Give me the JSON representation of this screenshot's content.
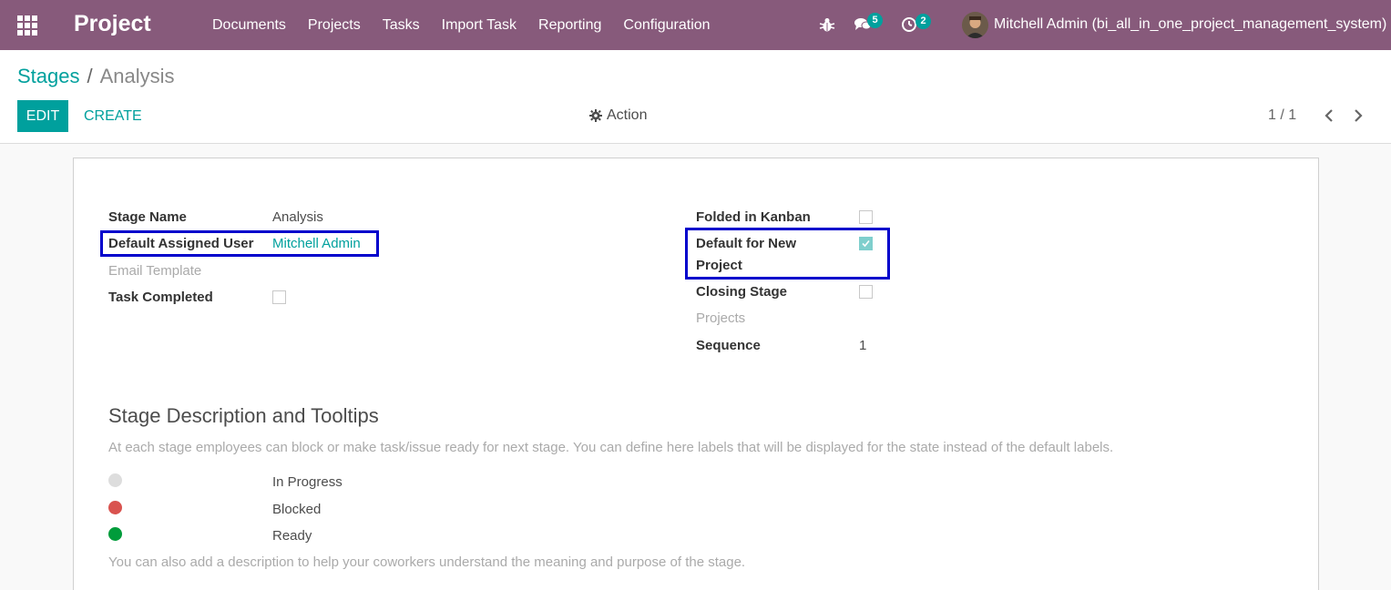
{
  "navbar": {
    "brand": "Project",
    "menu": [
      "Documents",
      "Projects",
      "Tasks",
      "Import Task",
      "Reporting",
      "Configuration"
    ],
    "chat_count": "5",
    "activity_count": "2",
    "user": "Mitchell Admin (bi_all_in_one_project_management_system)",
    "color": "#875a7b"
  },
  "breadcrumb": {
    "parent": "Stages",
    "separator": "/",
    "current": "Analysis"
  },
  "buttons": {
    "edit": "EDIT",
    "create": "CREATE",
    "action": "Action"
  },
  "pager": {
    "value": "1 / 1"
  },
  "form": {
    "stage_name_label": "Stage Name",
    "stage_name_value": "Analysis",
    "default_user_label": "Default Assigned User",
    "default_user_value": "Mitchell Admin",
    "email_template_label": "Email Template",
    "task_completed_label": "Task Completed",
    "task_completed": false,
    "folded_label": "Folded in Kanban",
    "folded": false,
    "default_new_project_label_1": "Default for New",
    "default_new_project_label_2": "Project",
    "default_new_project": true,
    "closing_label": "Closing Stage",
    "closing": false,
    "projects_label": "Projects",
    "sequence_label": "Sequence",
    "sequence_value": "1"
  },
  "description": {
    "title": "Stage Description and Tooltips",
    "help": "At each stage employees can block or make task/issue ready for next stage. You can define here labels that will be displayed for the state instead of the default labels.",
    "states": [
      {
        "label": "In Progress",
        "color": "#dddddd"
      },
      {
        "label": "Blocked",
        "color": "#d9534f"
      },
      {
        "label": "Ready",
        "color": "#009c3b"
      }
    ],
    "help2": "You can also add a description to help your coworkers understand the meaning and purpose of the stage."
  },
  "colors": {
    "accent": "#00a09d",
    "highlight": "#0000cc"
  }
}
